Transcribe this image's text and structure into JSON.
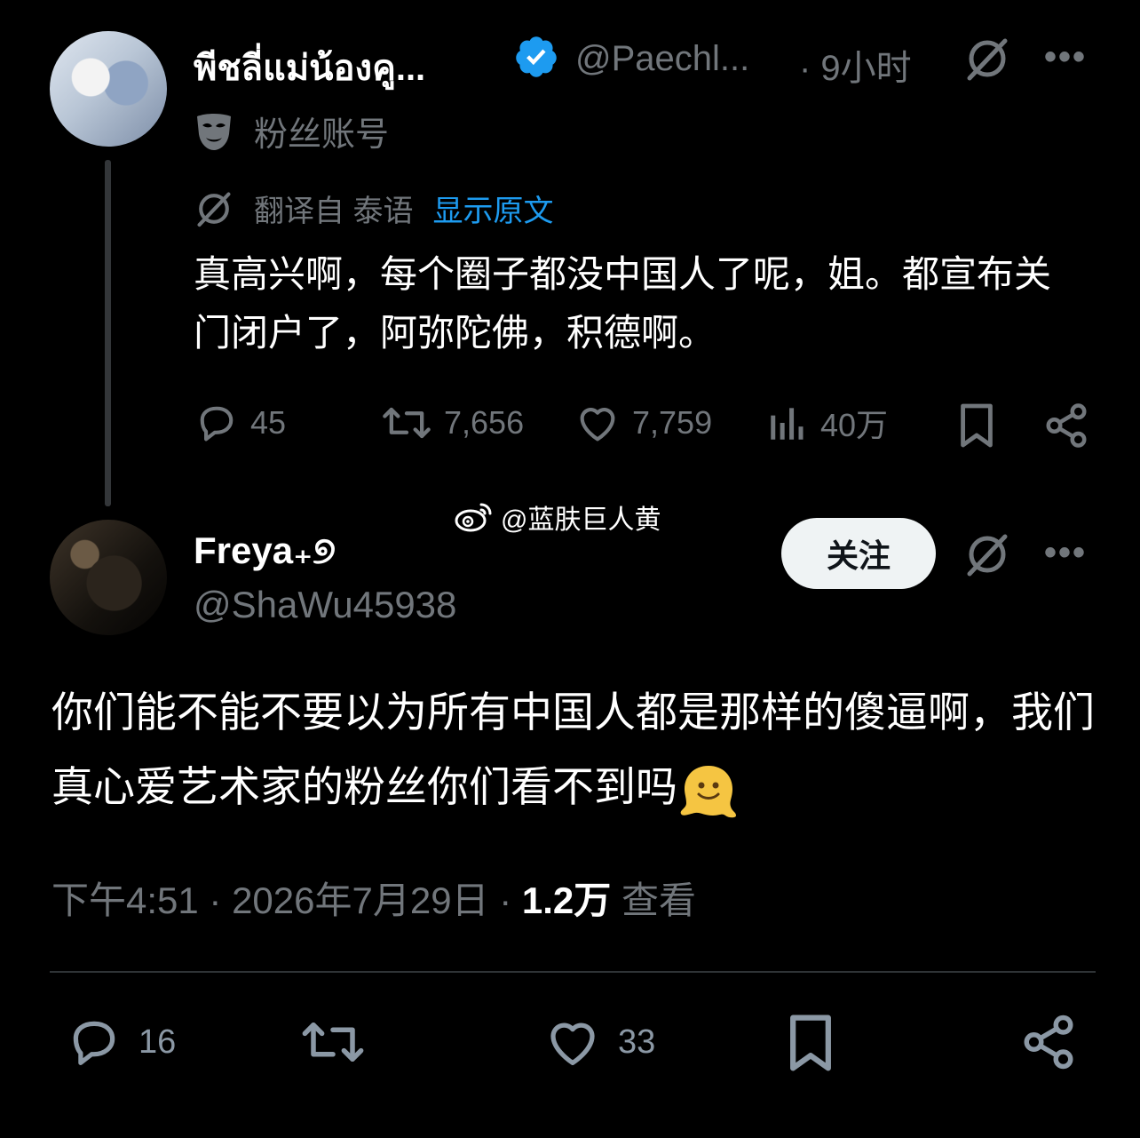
{
  "tweet1": {
    "display_name": "พีชลี่แม่น้องคู...",
    "handle": "@Paechl...",
    "time": "· 9小时",
    "account_label": "粉丝账号",
    "translated_from": "翻译自 泰语",
    "show_original": "显示原文",
    "text": "真高兴啊，每个圈子都没中国人了呢，姐。都宣布关门闭户了，阿弥陀佛，积德啊。",
    "metrics": {
      "replies": "45",
      "reposts": "7,656",
      "likes": "7,759",
      "views": "40万"
    },
    "verified_color": "#1d9bf0"
  },
  "watermark": "@蓝肤巨人黄",
  "tweet2": {
    "display_name": "Freya₊୭",
    "handle": "@ShaWu45938",
    "follow_label": "关注",
    "text": "你们能不能不要以为所有中国人都是那样的傻逼啊，我们真心爱艺术家的粉丝你们看不到吗",
    "emoji": "melting-face",
    "time": "下午4:51 · 2026年7月29日 · ",
    "views_count": "1.2万",
    "views_label": " 查看",
    "metrics": {
      "replies": "16",
      "likes": "33"
    }
  },
  "colors": {
    "background": "#000000",
    "text": "#e7e9ea",
    "muted": "#71767b",
    "link": "#1d9bf0"
  }
}
